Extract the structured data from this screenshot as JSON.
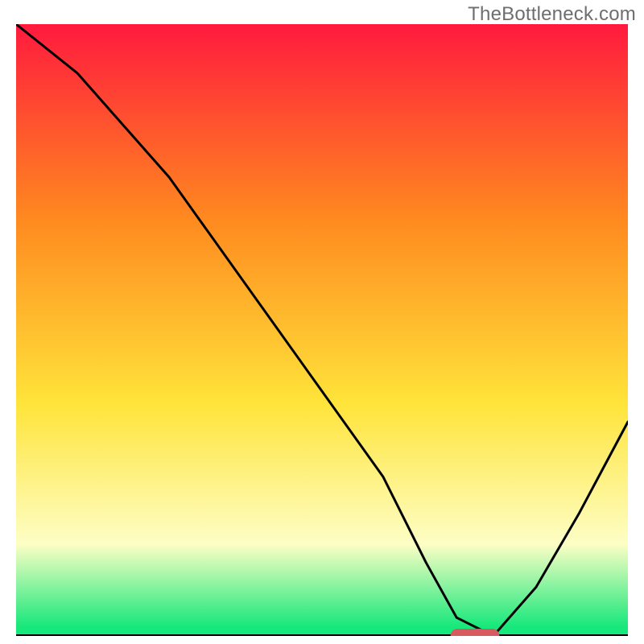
{
  "watermark": "TheBottleneck.com",
  "colors": {
    "red": "#ff1a3e",
    "orange": "#ff8a1f",
    "yellow": "#ffe43a",
    "pale": "#fdfec5",
    "green": "#17e87b",
    "line": "#000000",
    "marker": "#d65a5f",
    "axis": "#000000"
  },
  "chart_data": {
    "type": "line",
    "title": "",
    "xlabel": "",
    "ylabel": "",
    "xlim": [
      0,
      100
    ],
    "ylim": [
      0,
      100
    ],
    "x": [
      0,
      10,
      25,
      30,
      40,
      50,
      60,
      67,
      72,
      78,
      85,
      92,
      100
    ],
    "values": [
      100,
      92,
      75,
      68,
      54,
      40,
      26,
      12,
      3,
      0,
      8,
      20,
      35
    ],
    "marker": {
      "x": 75,
      "y": 0,
      "rx": 4,
      "ry": 1.5
    },
    "gradient_stops": [
      {
        "offset": 0.0,
        "key": "red"
      },
      {
        "offset": 0.32,
        "key": "orange"
      },
      {
        "offset": 0.62,
        "key": "yellow"
      },
      {
        "offset": 0.85,
        "key": "pale"
      },
      {
        "offset": 0.985,
        "key": "green"
      },
      {
        "offset": 1.0,
        "key": "green"
      }
    ]
  }
}
